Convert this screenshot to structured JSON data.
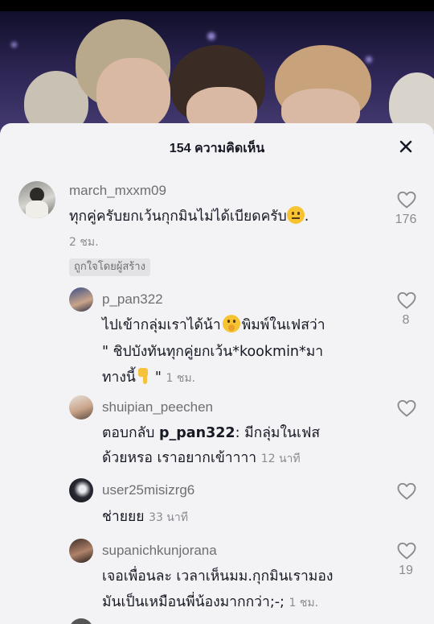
{
  "header": {
    "title": "154 ความคิดเห็น"
  },
  "comments": [
    {
      "username": "march_mxxm09",
      "text": "ทุกคู่ครับยกเว้นกุกมินไม่ได้เบียดครับ",
      "text_end": ".",
      "time": "2 ชม.",
      "badge": "ถูกใจโดยผู้สร้าง",
      "likes": "176"
    },
    {
      "username": "p_pan322",
      "line1": "ไปเข้ากลุ่มเราได้น้า",
      "line1_end": "พิมพ์ในเฟสว่า",
      "line2": "\" ชิปบังทันทุกคู่ยกเว้น*kookmin*มา",
      "line3": "ทางนี้",
      "line3_end": "\"",
      "time": "1 ชม.",
      "likes": "8"
    },
    {
      "username": "shuipian_peechen",
      "reply_prefix": "ตอบกลับ",
      "mention": "p_pan322",
      "line1_rest": ": มีกลุ่มในเฟส",
      "line2": "ด้วยหรอ เราอยากเข้าาาา",
      "time": "12 นาที"
    },
    {
      "username": "user25misizrg6",
      "text": "ช่ายยย",
      "time": "33 นาที"
    },
    {
      "username": "supanichkunjorana",
      "line1": "เจอเพื่อนละ เวลาเห็นมม.กุกมินเรามอง",
      "line2": "มันเป็นเหมือนพี่น้องมากกว่า;-;",
      "time": "1 ชม.",
      "likes": "19"
    }
  ]
}
